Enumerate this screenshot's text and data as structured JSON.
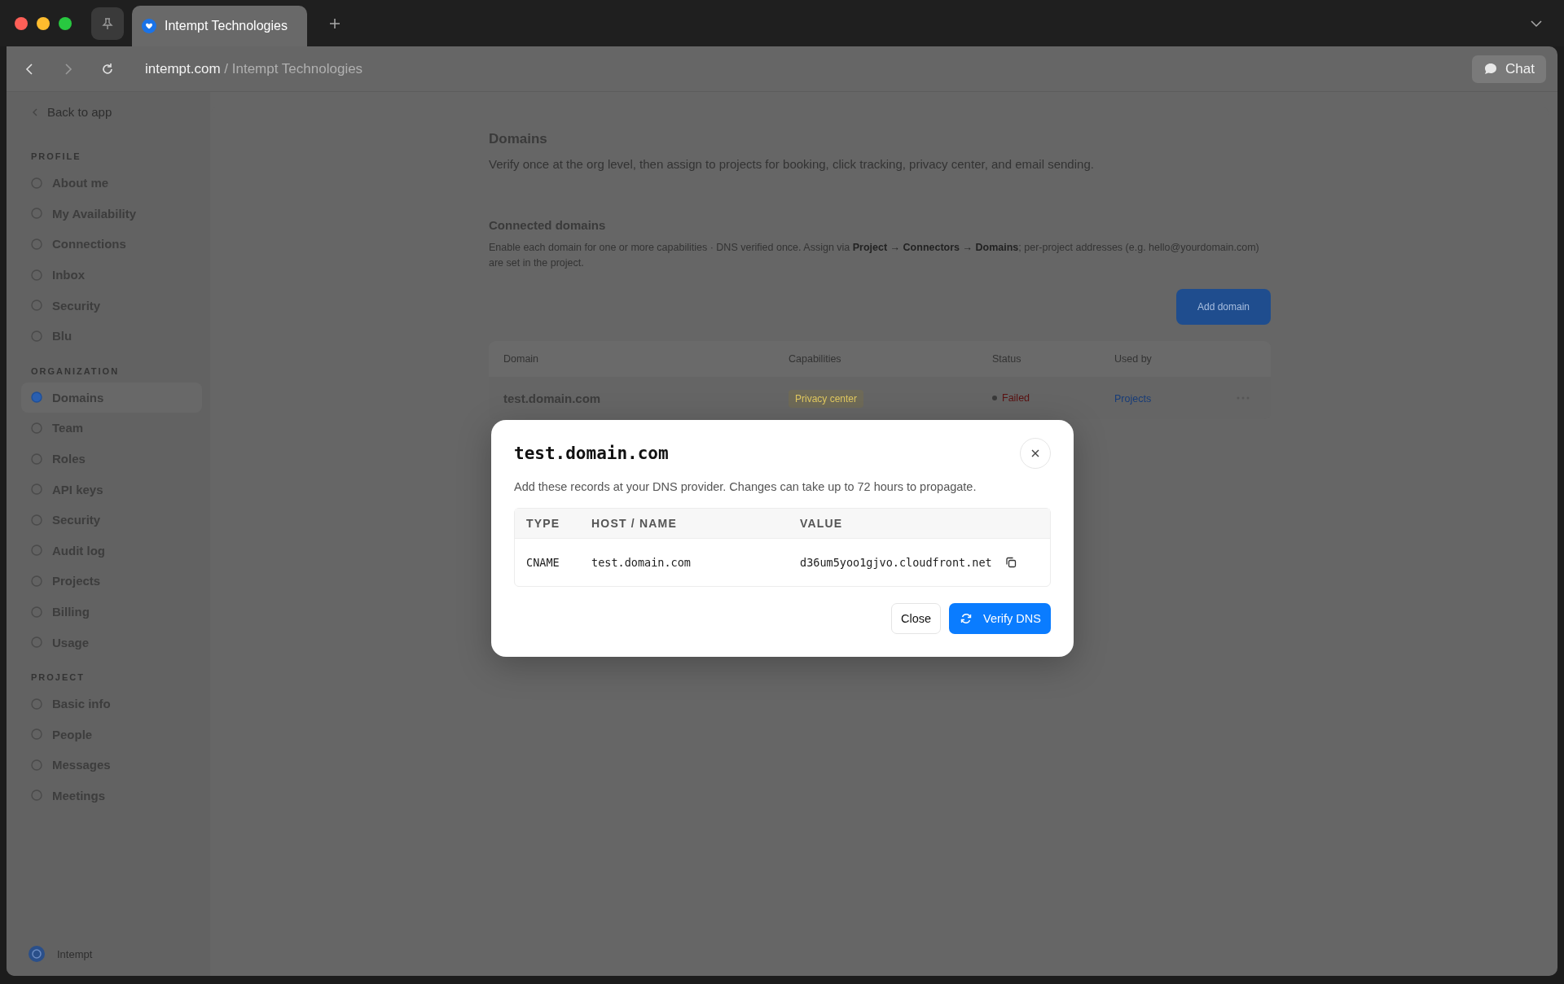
{
  "browser": {
    "tabs": [
      {
        "title": "Intempt Technologies",
        "selected": true
      }
    ],
    "address": {
      "domain": "intempt.com",
      "path": " / Intempt Technologies"
    },
    "chat_button": "Chat"
  },
  "sidebar": {
    "back_link": "Back to app",
    "sections": [
      {
        "title": "PROFILE",
        "items": [
          {
            "label": "About me",
            "selected": false
          },
          {
            "label": "My Availability",
            "selected": false
          },
          {
            "label": "Connections",
            "selected": false
          },
          {
            "label": "Inbox",
            "selected": false
          },
          {
            "label": "Security",
            "selected": false
          },
          {
            "label": "Blu",
            "selected": false
          }
        ]
      },
      {
        "title": "ORGANIZATION",
        "items": [
          {
            "label": "Domains",
            "selected": true
          },
          {
            "label": "Team",
            "selected": false
          },
          {
            "label": "Roles",
            "selected": false
          },
          {
            "label": "API keys",
            "selected": false
          },
          {
            "label": "Security",
            "selected": false
          },
          {
            "label": "Audit log",
            "selected": false
          },
          {
            "label": "Projects",
            "selected": false
          },
          {
            "label": "Billing",
            "selected": false
          },
          {
            "label": "Usage",
            "selected": false
          }
        ]
      },
      {
        "title": "PROJECT",
        "items": [
          {
            "label": "Basic info",
            "selected": false
          },
          {
            "label": "People",
            "selected": false
          },
          {
            "label": "Messages",
            "selected": false
          },
          {
            "label": "Meetings",
            "selected": false
          }
        ]
      }
    ],
    "footer": {
      "workspace": "Intempt"
    }
  },
  "page": {
    "title": "Domains",
    "subtitle": "Verify once at the org level, then assign to projects for booking, click tracking, privacy center, and email sending.",
    "section_title": "Connected domains",
    "section_description": "Enable each domain for one or more capabilities · DNS verified once. Assign via **Project → Connectors → Domains**; per-project addresses (e.g. hello@yourdomain.com) are set in the project.",
    "add_button": "Add domain",
    "table": {
      "columns": [
        "Domain",
        "Capabilities",
        "Status",
        "Used by"
      ],
      "rows": [
        {
          "domain": "test.domain.com",
          "capabilities": [
            "Privacy center"
          ],
          "status": "Failed",
          "used_by": "Projects"
        }
      ]
    }
  },
  "modal": {
    "title": "test.domain.com",
    "description": "Add these records at your DNS provider. Changes can take up to 72 hours to propagate.",
    "columns": [
      "TYPE",
      "HOST / NAME",
      "VALUE"
    ],
    "records": [
      {
        "type": "CNAME",
        "host": "test.domain.com",
        "value": "d36um5yoo1gjvo.cloudfront.net"
      }
    ],
    "buttons": {
      "close": "Close",
      "verify": "Verify DNS"
    }
  }
}
